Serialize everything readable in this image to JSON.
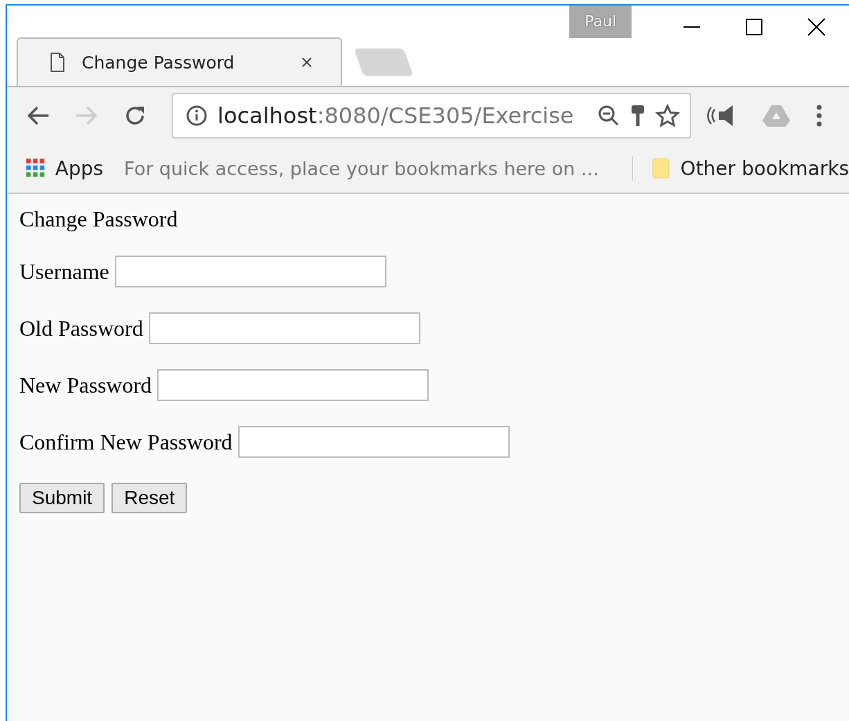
{
  "window": {
    "user": "Paul"
  },
  "tabs": [
    {
      "title": "Change Password",
      "selected": true
    }
  ],
  "address_bar": {
    "host": "localhost",
    "path": ":8080/CSE305/Exercise"
  },
  "bookmarks_bar": {
    "apps": "Apps",
    "hint": "For quick access, place your bookmarks here on ...",
    "other": "Other bookmarks"
  },
  "page": {
    "heading": "Change Password",
    "fields": [
      {
        "label": "Username"
      },
      {
        "label": "Old Password"
      },
      {
        "label": "New Password"
      },
      {
        "label": "Confirm New Password"
      }
    ],
    "buttons": [
      "Submit",
      "Reset"
    ]
  }
}
